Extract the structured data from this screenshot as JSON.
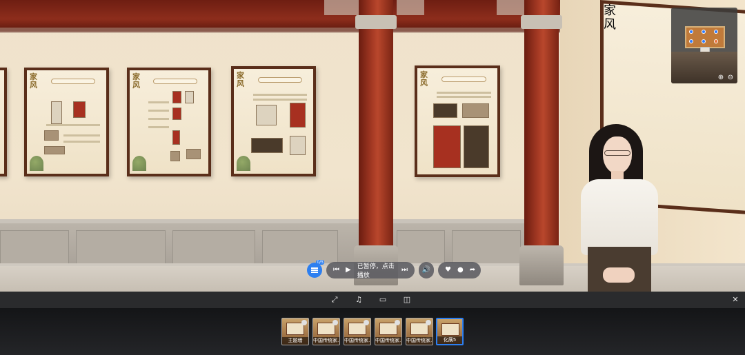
{
  "player": {
    "menu_badge": "0/5",
    "status_text": "已暂停，点击播放"
  },
  "thumbnails": [
    {
      "label": "主题墙"
    },
    {
      "label": "中国传统家..."
    },
    {
      "label": "中国传统家..."
    },
    {
      "label": "中国传统家..."
    },
    {
      "label": "中国传统家..."
    },
    {
      "label": "化展5"
    }
  ],
  "icons": {
    "fullscreen": "fullscreen-icon",
    "music": "music-icon",
    "vr": "vr-glasses-icon",
    "gyro": "gyroscope-icon",
    "close": "close-icon"
  },
  "colors": {
    "accent": "#2d7ff0",
    "column_red": "#a63a24",
    "frame_brown": "#5a2e1a"
  }
}
